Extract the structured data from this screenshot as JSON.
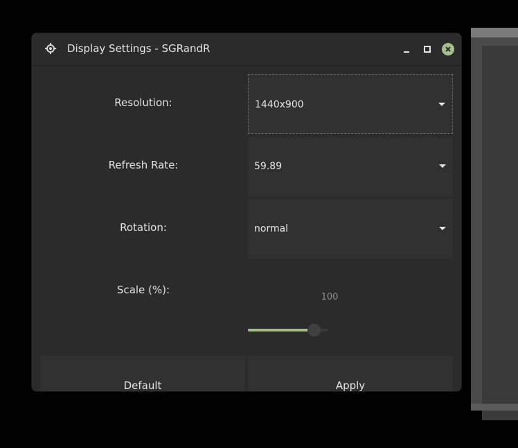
{
  "window": {
    "title": "Display Settings - SGRandR",
    "app_icon": "gear-icon",
    "controls": {
      "minimize_icon": "minimize-icon",
      "maximize_icon": "maximize-icon",
      "close_icon": "close-icon"
    }
  },
  "form": {
    "resolution": {
      "label": "Resolution:",
      "value": "1440x900"
    },
    "refresh_rate": {
      "label": "Refresh Rate:",
      "value": "59.89"
    },
    "rotation": {
      "label": "Rotation:",
      "value": "normal"
    },
    "scale": {
      "label": "Scale (%):",
      "value": "100",
      "level_fraction": 0.83
    }
  },
  "buttons": {
    "default_label": "Default",
    "apply_label": "Apply"
  },
  "colors": {
    "accent": "#a7c08a",
    "window_bg": "#2b2b2b",
    "control_bg": "#303030",
    "text": "#e6e6e6"
  }
}
